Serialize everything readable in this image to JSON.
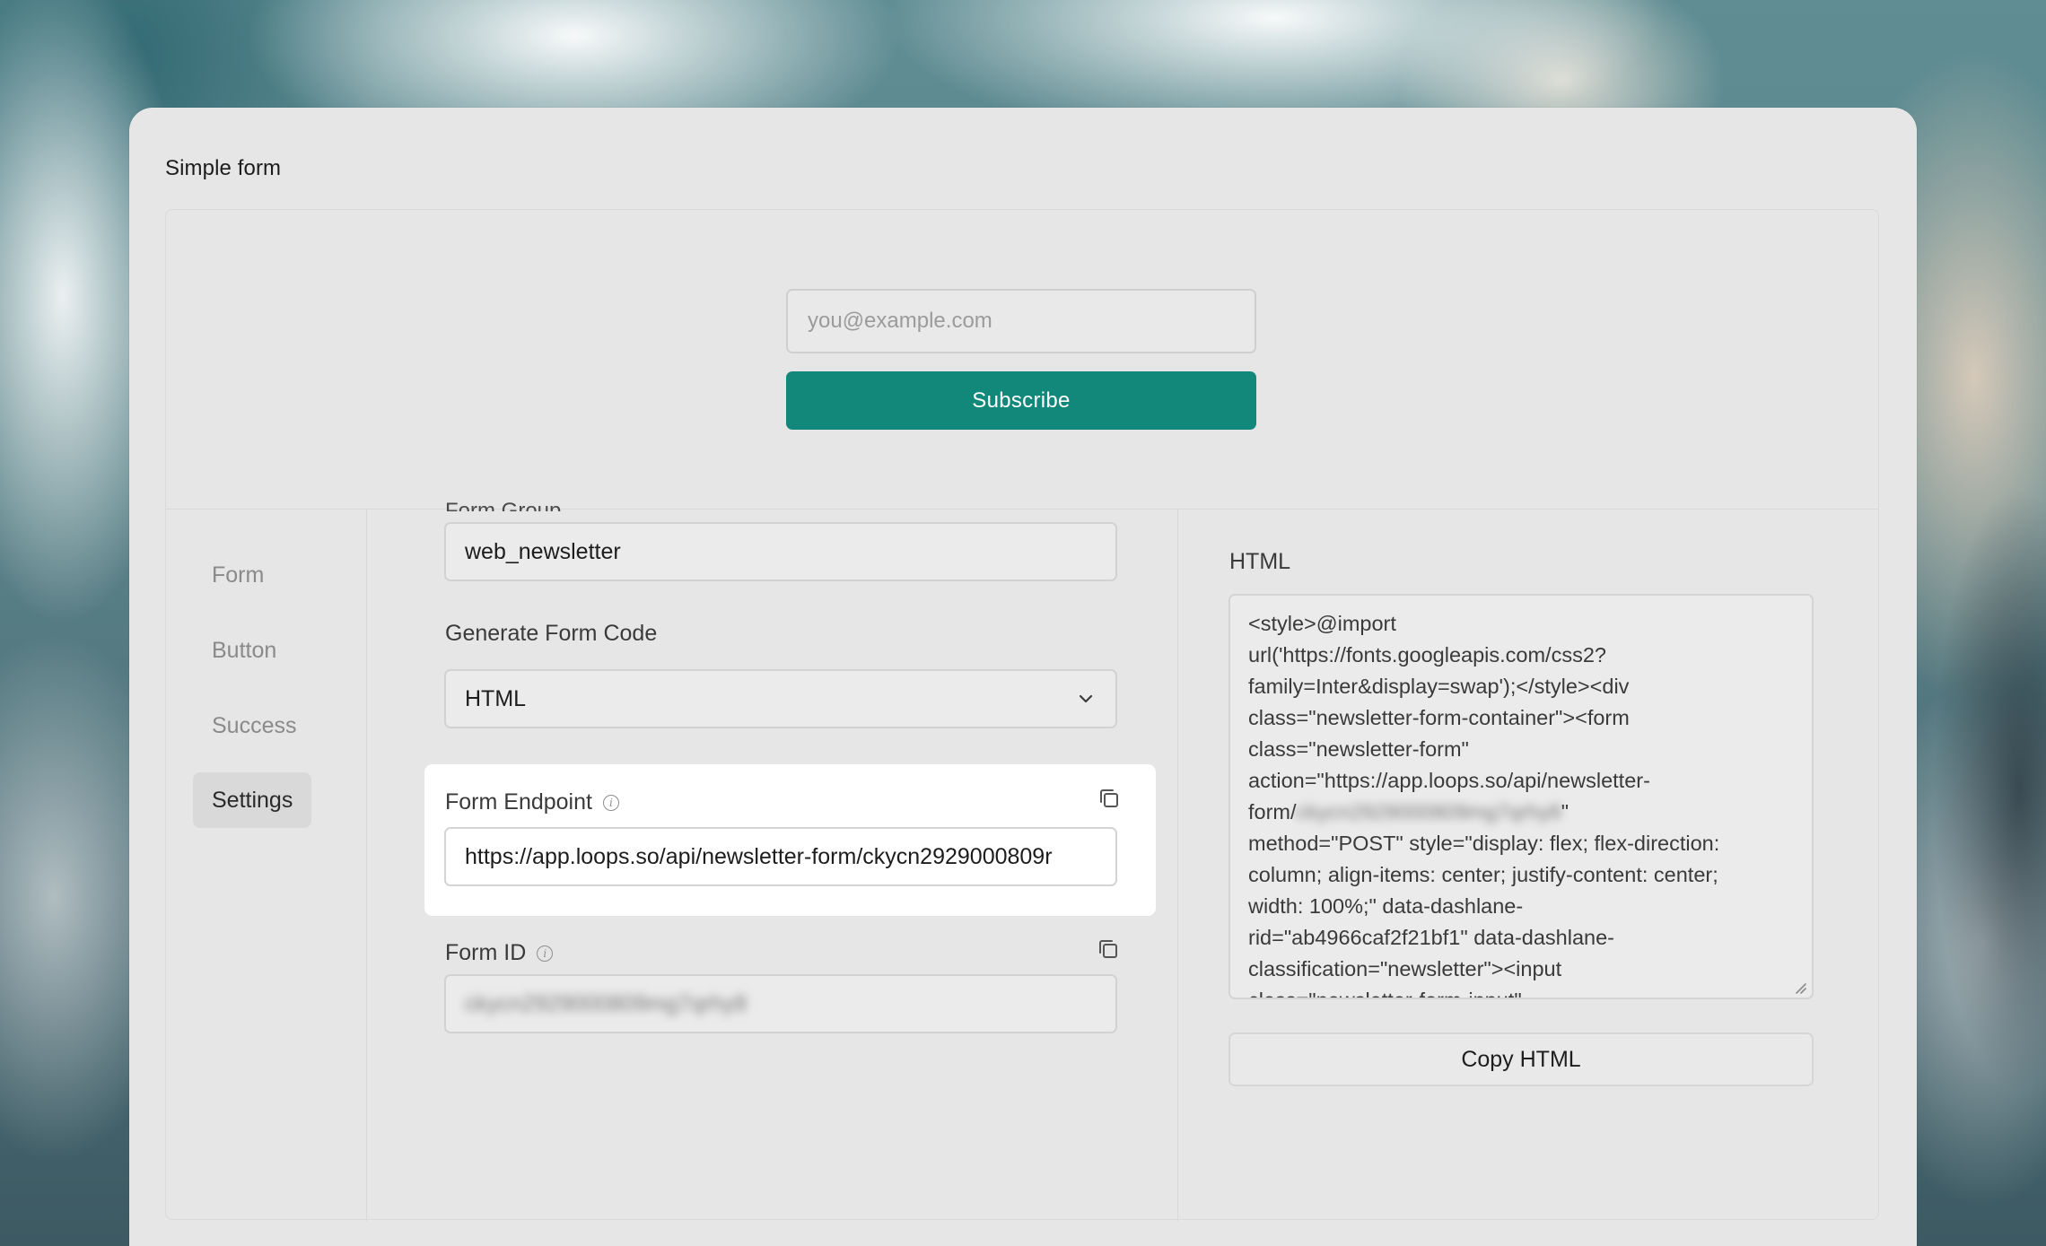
{
  "window": {
    "title": "Simple form"
  },
  "preview": {
    "email_placeholder": "you@example.com",
    "subscribe_label": "Subscribe",
    "button_color": "#12887a"
  },
  "sidebar": {
    "items": [
      {
        "label": "Form",
        "active": false
      },
      {
        "label": "Button",
        "active": false
      },
      {
        "label": "Success",
        "active": false
      },
      {
        "label": "Settings",
        "active": true
      }
    ]
  },
  "settings": {
    "partial_label": "Form Group",
    "user_group_value": "web_newsletter",
    "generate_code_label": "Generate Form Code",
    "generate_code_value": "HTML",
    "endpoint_label": "Form Endpoint",
    "endpoint_value": "https://app.loops.so/api/newsletter-form/ckycn2929000809r",
    "form_id_label": "Form ID",
    "form_id_value": "ckycn2929000809mg7qrhy8"
  },
  "html_panel": {
    "label": "HTML",
    "code_lines": [
      "<style>@import",
      "url('https://fonts.googleapis.com/css2?",
      "family=Inter&display=swap');</style><div",
      "class=\"newsletter-form-container\"><form",
      "class=\"newsletter-form\"",
      "action=\"https://app.loops.so/api/newsletter-",
      "method=\"POST\" style=\"display: flex; flex-direction:",
      "column; align-items: center; justify-content: center;",
      "width: 100%;\" data-dashlane-",
      "rid=\"ab4966caf2f21bf1\" data-dashlane-",
      "classification=\"newsletter\"><input",
      "class=\"newsletter-form-input\""
    ],
    "form_prefix": "form/",
    "form_blurred": "ckycn2929000809mg7qrhy8",
    "form_quote": "\"",
    "copy_button_label": "Copy HTML"
  }
}
